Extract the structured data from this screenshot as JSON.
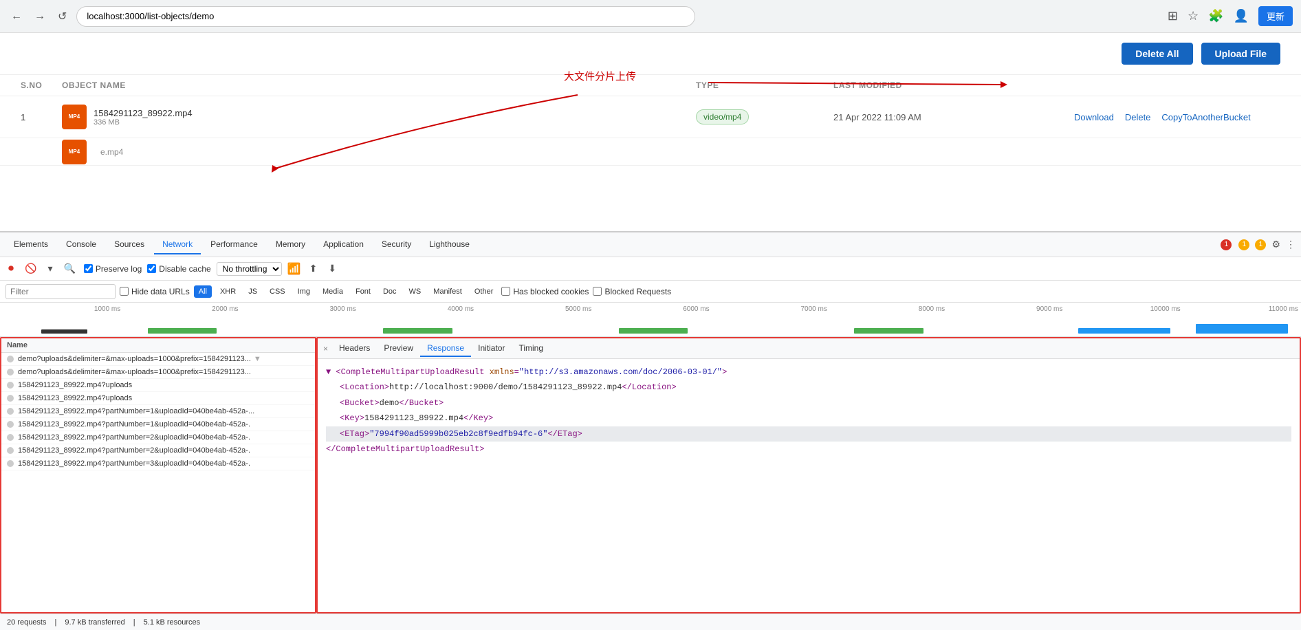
{
  "browser": {
    "back_label": "←",
    "forward_label": "→",
    "refresh_label": "↺",
    "address": "localhost:3000/list-objects/demo",
    "update_label": "更新"
  },
  "app": {
    "delete_all_label": "Delete All",
    "upload_file_label": "Upload File",
    "table": {
      "columns": [
        "S.NO",
        "OBJECT NAME",
        "TYPE",
        "LAST MODIFIED",
        ""
      ],
      "rows": [
        {
          "sno": "1",
          "file_name": "1584291123_89922.mp4",
          "file_size": "336 MB",
          "type": "video/mp4",
          "last_modified": "21 Apr 2022 11:09 AM",
          "actions": [
            "Download",
            "Delete",
            "CopyToAnotherBucket"
          ]
        }
      ],
      "partial_row_name": "e.mp4"
    }
  },
  "annotation": {
    "chinese_text": "大文件分片上传"
  },
  "devtools": {
    "tabs": [
      "Elements",
      "Console",
      "Sources",
      "Network",
      "Performance",
      "Memory",
      "Application",
      "Security",
      "Lighthouse"
    ],
    "active_tab": "Network",
    "error_count": "1",
    "warning_count": "1",
    "info_count": "1",
    "toolbar": {
      "preserve_log": "Preserve log",
      "disable_cache": "Disable cache",
      "throttle": "No throttling"
    },
    "filter": {
      "placeholder": "Filter",
      "hide_data_urls": "Hide data URLs",
      "tags": [
        "All",
        "XHR",
        "JS",
        "CSS",
        "Img",
        "Media",
        "Font",
        "Doc",
        "WS",
        "Manifest",
        "Other"
      ],
      "active_tag": "All",
      "has_blocked": "Has blocked cookies",
      "blocked_requests": "Blocked Requests"
    },
    "timeline": {
      "labels": [
        "1000 ms",
        "2000 ms",
        "3000 ms",
        "4000 ms",
        "5000 ms",
        "6000 ms",
        "7000 ms",
        "8000 ms",
        "9000 ms",
        "10000 ms",
        "11000 ms"
      ]
    },
    "requests": [
      "demo?uploads&delimiter=&max-uploads=1000&prefix=1584291123...",
      "demo?uploads&delimiter=&max-uploads=1000&prefix=1584291123...",
      "1584291123_89922.mp4?uploads",
      "1584291123_89922.mp4?uploads",
      "1584291123_89922.mp4?partNumber=1&uploadId=040be4ab-452a-...",
      "1584291123_89922.mp4?partNumber=1&uploadId=040be4ab-452a-.",
      "1584291123_89922.mp4?partNumber=2&uploadId=040be4ab-452a-.",
      "1584291123_89922.mp4?partNumber=2&uploadId=040be4ab-452a-.",
      "1584291123_89922.mp4?partNumber=3&uploadId=040be4ab-452a-."
    ],
    "response_tabs": [
      "×",
      "Headers",
      "Preview",
      "Response",
      "Initiator",
      "Timing"
    ],
    "active_response_tab": "Response",
    "response_xml": {
      "line1": "<CompleteMultipartUploadResult xmlns=\"http://s3.amazonaws.com/doc/2006-03-01/\">",
      "line2": "    <Location>http://localhost:9000/demo/1584291123_89922.mp4</Location>",
      "line3": "    <Bucket>demo</Bucket>",
      "line4": "    <Key>1584291123_89922.mp4</Key>",
      "line5": "    <ETag>\"7994f90ad5999b025eb2c8f9edfb94fc-6\"</ETag>",
      "line6": "</CompleteMultipartUploadResult>"
    },
    "status": {
      "requests": "20 requests",
      "transferred": "9.7 kB transferred",
      "resources": "5.1 kB resources"
    }
  }
}
